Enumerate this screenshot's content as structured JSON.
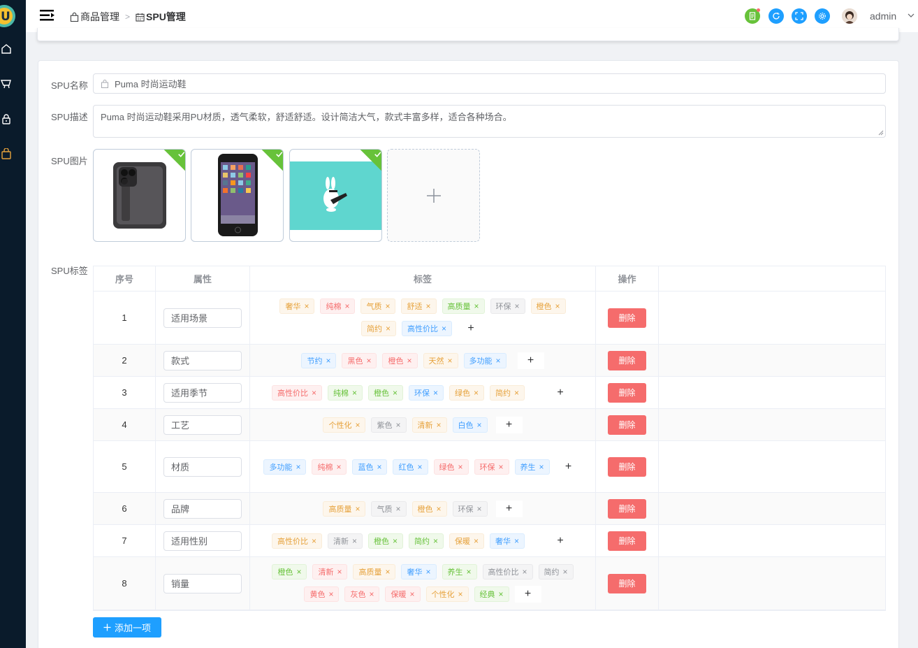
{
  "app": {
    "logo_letter": "U",
    "user": "admin"
  },
  "breadcrumb": [
    {
      "label": "商品管理",
      "icon": "bag-icon"
    },
    {
      "label": "SPU管理",
      "icon": "calendar-icon"
    }
  ],
  "header_colors": {
    "doc": "#67c23a",
    "refresh": "#1e9fff",
    "fullscreen": "#1e9fff",
    "settings": "#1e9fff"
  },
  "form": {
    "name_label": "SPU名称",
    "name_value": "Puma 时尚运动鞋",
    "desc_label": "SPU描述",
    "desc_value": "Puma 时尚运动鞋采用PU材质，透气柔软，舒适舒适。设计简洁大气，款式丰富多样，适合各种场合。",
    "image_label": "SPU图片",
    "tag_label": "SPU标签"
  },
  "table": {
    "headers": {
      "index": "序号",
      "attr": "属性",
      "tags": "标签",
      "op": "操作"
    },
    "delete_label": "删除",
    "add_tag_label": "+",
    "rows": [
      {
        "index": "1",
        "attr": "适用场景",
        "tags": [
          [
            "奢华",
            "o"
          ],
          [
            "纯棉",
            "r"
          ],
          [
            "气质",
            "o"
          ],
          [
            "舒适",
            "o"
          ],
          [
            "高质量",
            "g"
          ],
          [
            "环保",
            "i"
          ],
          [
            "橙色",
            "o"
          ],
          [
            "简约",
            "o"
          ],
          [
            "高性价比",
            "b"
          ]
        ]
      },
      {
        "index": "2",
        "attr": "款式",
        "tags": [
          [
            "节约",
            "b"
          ],
          [
            "黑色",
            "r"
          ],
          [
            "橙色",
            "r"
          ],
          [
            "天然",
            "o"
          ],
          [
            "多功能",
            "b"
          ]
        ]
      },
      {
        "index": "3",
        "attr": "适用季节",
        "tags": [
          [
            "高性价比",
            "r"
          ],
          [
            "纯棉",
            "g"
          ],
          [
            "橙色",
            "g"
          ],
          [
            "环保",
            "b"
          ],
          [
            "绿色",
            "o"
          ],
          [
            "简约",
            "o"
          ]
        ]
      },
      {
        "index": "4",
        "attr": "工艺",
        "tags": [
          [
            "个性化",
            "o"
          ],
          [
            "紫色",
            "i"
          ],
          [
            "清新",
            "o"
          ],
          [
            "白色",
            "b"
          ]
        ]
      },
      {
        "index": "5",
        "attr": "材质",
        "tags": [
          [
            "多功能",
            "b"
          ],
          [
            "纯棉",
            "r"
          ],
          [
            "蓝色",
            "b"
          ],
          [
            "红色",
            "b"
          ],
          [
            "绿色",
            "r"
          ],
          [
            "环保",
            "r"
          ],
          [
            "养生",
            "b"
          ]
        ]
      },
      {
        "index": "6",
        "attr": "品牌",
        "tags": [
          [
            "高质量",
            "o"
          ],
          [
            "气质",
            "i"
          ],
          [
            "橙色",
            "o"
          ],
          [
            "环保",
            "i"
          ]
        ]
      },
      {
        "index": "7",
        "attr": "适用性别",
        "tags": [
          [
            "高性价比",
            "o"
          ],
          [
            "清新",
            "i"
          ],
          [
            "橙色",
            "g"
          ],
          [
            "简约",
            "g"
          ],
          [
            "保暖",
            "o"
          ],
          [
            "奢华",
            "b"
          ]
        ]
      },
      {
        "index": "8",
        "attr": "销量",
        "tags": [
          [
            "橙色",
            "g"
          ],
          [
            "清新",
            "r"
          ],
          [
            "高质量",
            "o"
          ],
          [
            "奢华",
            "b"
          ],
          [
            "养生",
            "g"
          ],
          [
            "高性价比",
            "i"
          ],
          [
            "简约",
            "i"
          ],
          [
            "黄色",
            "r"
          ],
          [
            "灰色",
            "r"
          ],
          [
            "保暖",
            "r"
          ],
          [
            "个性化",
            "o"
          ],
          [
            "经典",
            "g"
          ]
        ]
      }
    ]
  },
  "add_row_label": "添加一项",
  "tag_colors": {
    "o": {
      "bg": "#fdf6ec",
      "border": "#faecd8",
      "color": "#e6a23c"
    },
    "r": {
      "bg": "#fef0f0",
      "border": "#fde2e2",
      "color": "#f56c6c"
    },
    "g": {
      "bg": "#f0f9eb",
      "border": "#e1f3d8",
      "color": "#67c23a"
    },
    "b": {
      "bg": "#ecf5ff",
      "border": "#d9ecff",
      "color": "#409eff"
    },
    "i": {
      "bg": "#f4f4f5",
      "border": "#e9e9eb",
      "color": "#909399"
    }
  }
}
